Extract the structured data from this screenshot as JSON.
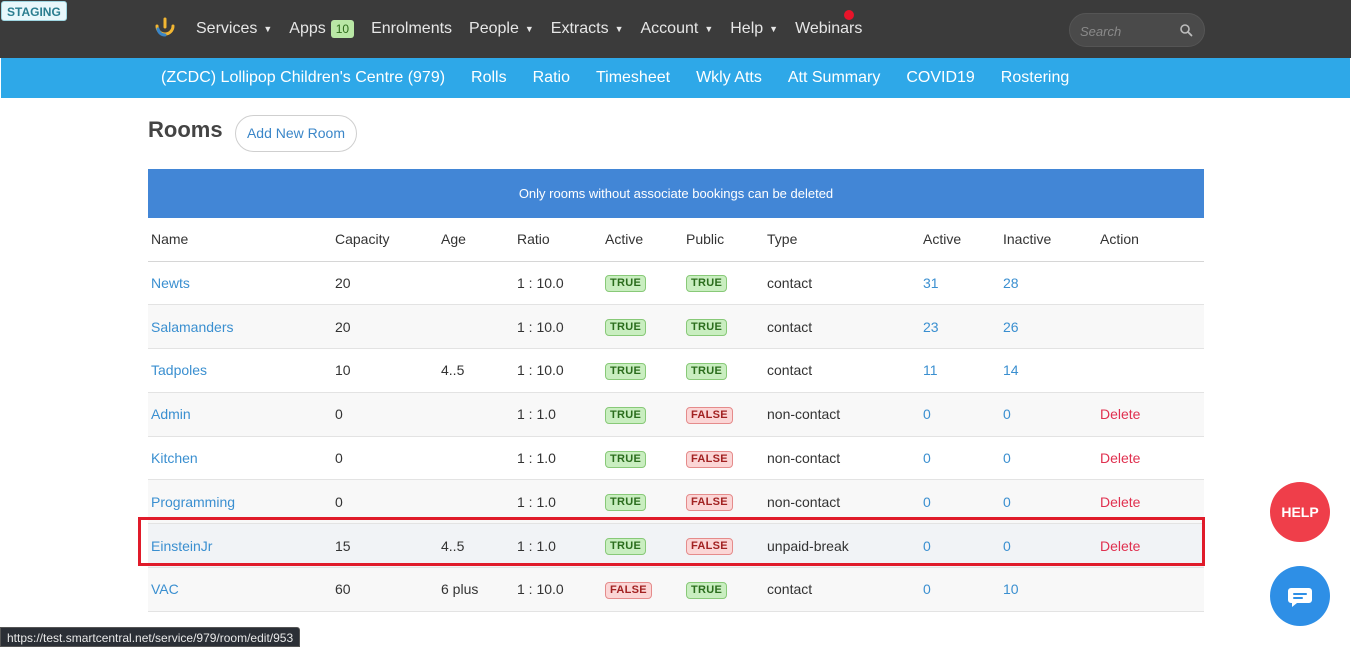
{
  "staging_label": "STAGING",
  "nav": {
    "services": "Services",
    "apps": "Apps",
    "apps_badge": "10",
    "enrolments": "Enrolments",
    "people": "People",
    "extracts": "Extracts",
    "account": "Account",
    "help": "Help",
    "webinars": "Webinars"
  },
  "search": {
    "placeholder": "Search"
  },
  "subnav": {
    "centre": "(ZCDC) Lollipop Children's Centre (979)",
    "rolls": "Rolls",
    "ratio": "Ratio",
    "timesheet": "Timesheet",
    "wkly_atts": "Wkly Atts",
    "att_summary": "Att Summary",
    "covid19": "COVID19",
    "rostering": "Rostering"
  },
  "page": {
    "title": "Rooms",
    "add_button": "Add New Room",
    "notice": "Only rooms without associate bookings can be deleted"
  },
  "table": {
    "headers": [
      "Name",
      "Capacity",
      "Age",
      "Ratio",
      "Active",
      "Public",
      "Type",
      "Active",
      "Inactive",
      "Action"
    ],
    "rows": [
      {
        "name": "Newts",
        "capacity": "20",
        "age": "",
        "ratio": "1 : 10.0",
        "active": "TRUE",
        "public": "TRUE",
        "type": "contact",
        "active_count": "31",
        "inactive_count": "28",
        "action": ""
      },
      {
        "name": "Salamanders",
        "capacity": "20",
        "age": "",
        "ratio": "1 : 10.0",
        "active": "TRUE",
        "public": "TRUE",
        "type": "contact",
        "active_count": "23",
        "inactive_count": "26",
        "action": ""
      },
      {
        "name": "Tadpoles",
        "capacity": "10",
        "age": "4..5",
        "ratio": "1 : 10.0",
        "active": "TRUE",
        "public": "TRUE",
        "type": "contact",
        "active_count": "11",
        "inactive_count": "14",
        "action": ""
      },
      {
        "name": "Admin",
        "capacity": "0",
        "age": "",
        "ratio": "1 : 1.0",
        "active": "TRUE",
        "public": "FALSE",
        "type": "non-contact",
        "active_count": "0",
        "inactive_count": "0",
        "action": "Delete"
      },
      {
        "name": "Kitchen",
        "capacity": "0",
        "age": "",
        "ratio": "1 : 1.0",
        "active": "TRUE",
        "public": "FALSE",
        "type": "non-contact",
        "active_count": "0",
        "inactive_count": "0",
        "action": "Delete"
      },
      {
        "name": "Programming",
        "capacity": "0",
        "age": "",
        "ratio": "1 : 1.0",
        "active": "TRUE",
        "public": "FALSE",
        "type": "non-contact",
        "active_count": "0",
        "inactive_count": "0",
        "action": "Delete"
      },
      {
        "name": "EinsteinJr",
        "capacity": "15",
        "age": "4..5",
        "ratio": "1 : 1.0",
        "active": "TRUE",
        "public": "FALSE",
        "type": "unpaid-break",
        "active_count": "0",
        "inactive_count": "0",
        "action": "Delete"
      },
      {
        "name": "VAC",
        "capacity": "60",
        "age": "6 plus",
        "ratio": "1 : 10.0",
        "active": "FALSE",
        "public": "TRUE",
        "type": "contact",
        "active_count": "0",
        "inactive_count": "10",
        "action": ""
      }
    ]
  },
  "help_button": "HELP",
  "status_url": "https://test.smartcentral.net/service/979/room/edit/953",
  "colors": {
    "topbar": "#3b3b3b",
    "subbar": "#2ea8e8",
    "notice": "#4286d6",
    "link": "#3a8fd0",
    "delete": "#e0304f",
    "highlight": "#e01b2a"
  }
}
